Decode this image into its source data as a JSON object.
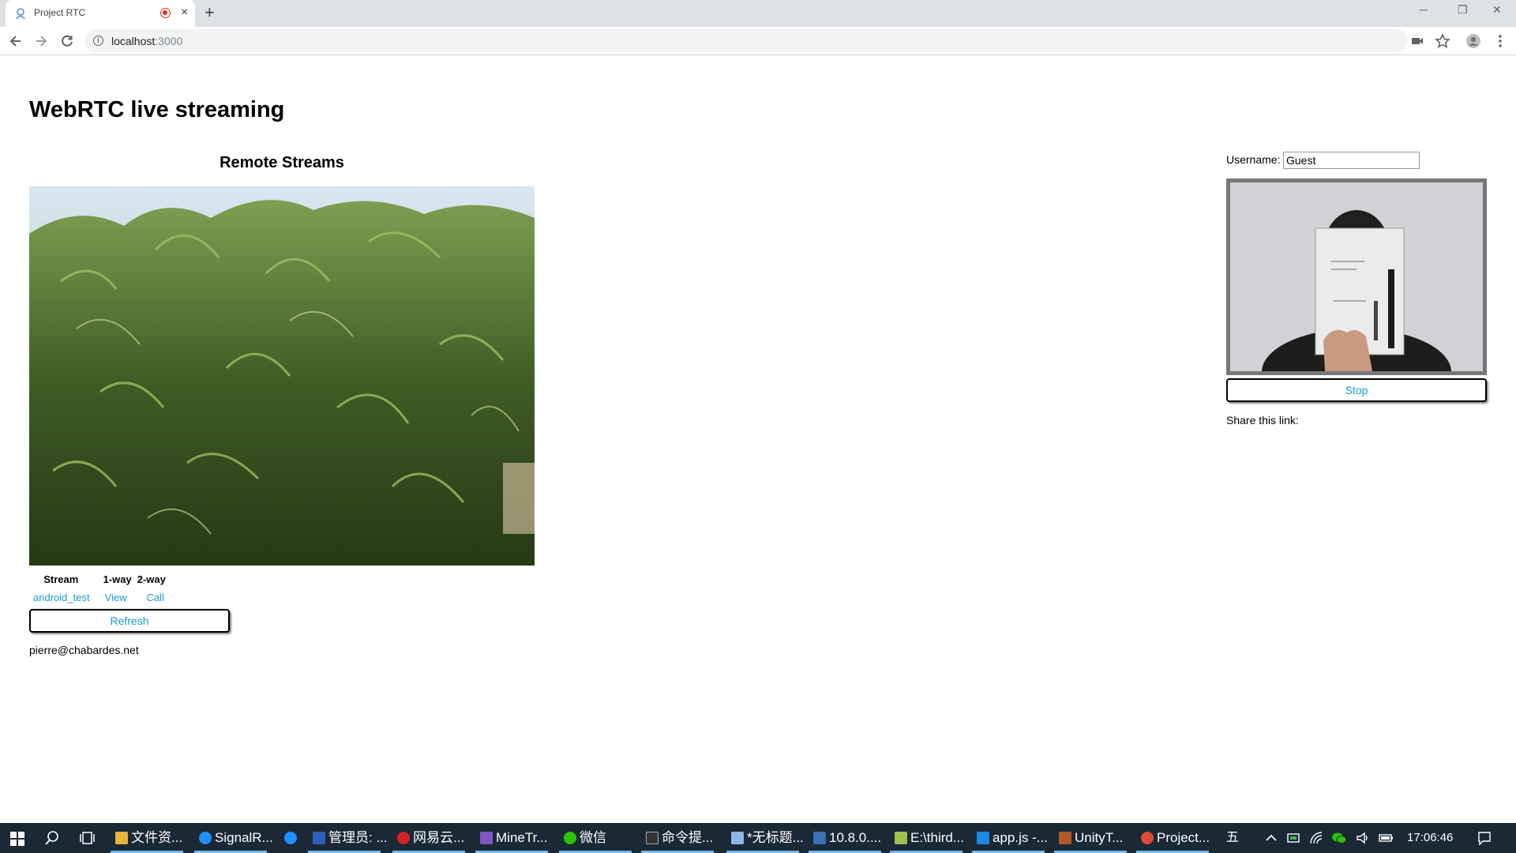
{
  "browser": {
    "tab_title": "Project RTC",
    "tab_close": "×",
    "new_tab": "+",
    "url_host": "localhost",
    "url_port": ":3000",
    "win_min": "─",
    "win_restore": "❐",
    "win_close": "✕"
  },
  "page": {
    "title": "WebRTC live streaming",
    "remote_heading": "Remote Streams",
    "table": {
      "headers": [
        "Stream",
        "1-way",
        "2-way"
      ],
      "rows": [
        {
          "stream": "android_test",
          "one_way": "View",
          "two_way": "Call"
        }
      ]
    },
    "refresh_label": "Refresh",
    "footer_email": "pierre@chabardes.net",
    "username_label": "Username:",
    "username_value": "Guest",
    "stop_label": "Stop",
    "share_label": "Share this link:"
  },
  "taskbar": {
    "tasks": [
      {
        "label": "文件资...",
        "icon_color": "#e8b33a"
      },
      {
        "label": "SignalR...",
        "icon_color": "#1e90ff"
      },
      {
        "label": "",
        "icon_color": "#1e90ff"
      },
      {
        "label": "管理员: ...",
        "icon_color": "#2f5fb8"
      },
      {
        "label": "网易云...",
        "icon_color": "#d3222a"
      },
      {
        "label": "MineTr...",
        "icon_color": "#7e57c2"
      },
      {
        "label": "微信",
        "icon_color": "#2dc100"
      },
      {
        "label": "命令提...",
        "icon_color": "#333333"
      },
      {
        "label": "*无标题...",
        "icon_color": "#8fb7e6"
      },
      {
        "label": "10.8.0....",
        "icon_color": "#3c6fb4"
      },
      {
        "label": "E:\\third...",
        "icon_color": "#a0c050"
      },
      {
        "label": "app.js -...",
        "icon_color": "#1e88e5"
      },
      {
        "label": "UnityT...",
        "icon_color": "#b05a2a"
      },
      {
        "label": "Project...",
        "icon_color": "#dd4b39"
      }
    ],
    "ime": "五",
    "clock": "17:06:46"
  },
  "colors": {
    "link": "#1a9bd7",
    "taskbar_bg": "#1b2836",
    "tab_bar": "#dee1e6",
    "record_red": "#d93025"
  }
}
